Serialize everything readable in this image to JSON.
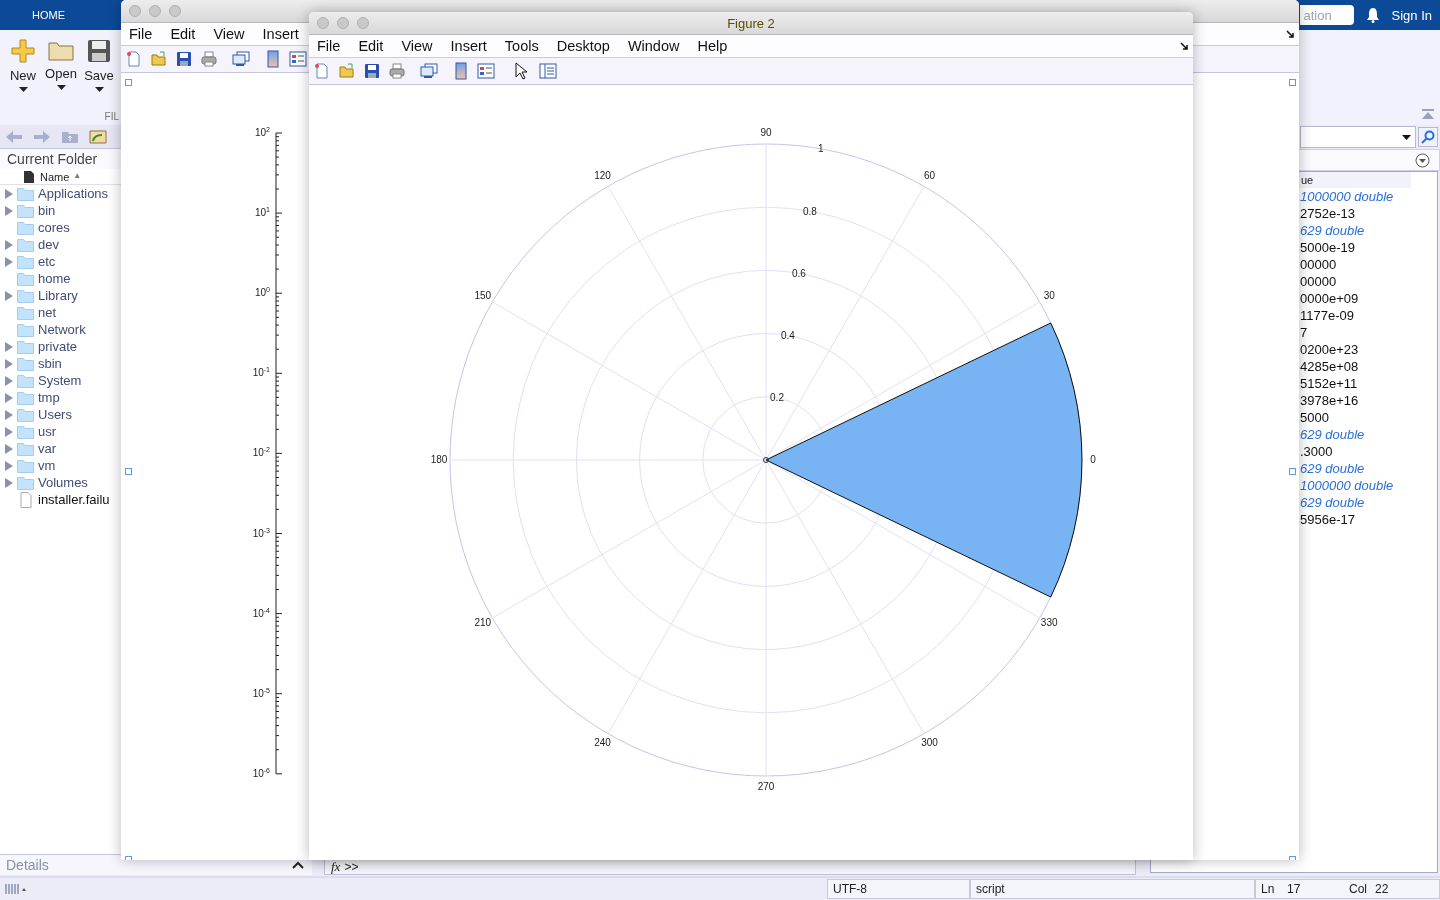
{
  "app": {
    "home_tab": "HOME",
    "search": {
      "value": "ation"
    },
    "sign_in": "Sign In",
    "ribbon": {
      "buttons": [
        {
          "label": "New",
          "kind": "new"
        },
        {
          "label": "Open",
          "kind": "open"
        },
        {
          "label": "Save",
          "kind": "save"
        }
      ],
      "section": "FIL"
    }
  },
  "current_folder": {
    "title": "Current Folder",
    "column": "Name",
    "sort": "▲",
    "items": [
      {
        "name": "Applications",
        "kind": "folder",
        "expandable": true
      },
      {
        "name": "bin",
        "kind": "folder",
        "expandable": true
      },
      {
        "name": "cores",
        "kind": "folder",
        "expandable": false
      },
      {
        "name": "dev",
        "kind": "folder",
        "expandable": true
      },
      {
        "name": "etc",
        "kind": "folder",
        "expandable": true
      },
      {
        "name": "home",
        "kind": "folder",
        "expandable": false
      },
      {
        "name": "Library",
        "kind": "folder",
        "expandable": true
      },
      {
        "name": "net",
        "kind": "folder",
        "expandable": false
      },
      {
        "name": "Network",
        "kind": "folder",
        "expandable": false
      },
      {
        "name": "private",
        "kind": "folder",
        "expandable": true
      },
      {
        "name": "sbin",
        "kind": "folder",
        "expandable": true
      },
      {
        "name": "System",
        "kind": "folder",
        "expandable": true
      },
      {
        "name": "tmp",
        "kind": "folder",
        "expandable": true
      },
      {
        "name": "Users",
        "kind": "folder",
        "expandable": true
      },
      {
        "name": "usr",
        "kind": "folder",
        "expandable": true
      },
      {
        "name": "var",
        "kind": "folder",
        "expandable": true
      },
      {
        "name": "vm",
        "kind": "folder",
        "expandable": true
      },
      {
        "name": "Volumes",
        "kind": "folder",
        "expandable": true
      },
      {
        "name": "installer.failu",
        "kind": "file",
        "expandable": false
      }
    ]
  },
  "details": {
    "label": "Details"
  },
  "command_window": {
    "fx": "fx",
    "prompt": ">>"
  },
  "workspace": {
    "column": "ue",
    "rows": [
      {
        "value": "1000000 double",
        "kind": "array"
      },
      {
        "value": "2752e-13",
        "kind": "scalar"
      },
      {
        "value": "629 double",
        "kind": "array"
      },
      {
        "value": "5000e-19",
        "kind": "scalar"
      },
      {
        "value": "00000",
        "kind": "scalar"
      },
      {
        "value": "00000",
        "kind": "scalar"
      },
      {
        "value": "0000e+09",
        "kind": "scalar"
      },
      {
        "value": "1177e-09",
        "kind": "scalar"
      },
      {
        "value": "7",
        "kind": "scalar"
      },
      {
        "value": "0200e+23",
        "kind": "scalar"
      },
      {
        "value": "4285e+08",
        "kind": "scalar"
      },
      {
        "value": "5152e+11",
        "kind": "scalar"
      },
      {
        "value": "3978e+16",
        "kind": "scalar"
      },
      {
        "value": "5000",
        "kind": "scalar"
      },
      {
        "value": "629 double",
        "kind": "array"
      },
      {
        "value": ".3000",
        "kind": "scalar"
      },
      {
        "value": "629 double",
        "kind": "array"
      },
      {
        "value": "1000000 double",
        "kind": "array"
      },
      {
        "value": "629 double",
        "kind": "array"
      },
      {
        "value": "5956e-17",
        "kind": "scalar"
      }
    ]
  },
  "status_bar": {
    "encoding": "UTF-8",
    "file_type": "script",
    "line_label": "Ln",
    "line": "17",
    "col_label": "Col",
    "col": "22"
  },
  "figure_1": {
    "menu": [
      "File",
      "Edit",
      "View",
      "Insert"
    ],
    "y_tick_labels": [
      "10$^{2}$",
      "10$^{1}$",
      "10$^{0}$",
      "10$^{-1}$",
      "10$^{-2}$",
      "10$^{-3}$",
      "10$^{-4}$",
      "10$^{-5}$",
      "10$^{-6}$"
    ]
  },
  "figure_2": {
    "title": "Figure 2",
    "menu": [
      "File",
      "Edit",
      "View",
      "Insert",
      "Tools",
      "Desktop",
      "Window",
      "Help"
    ],
    "polar": {
      "angle_labels": [
        "90",
        "60",
        "30",
        "0",
        "330",
        "300",
        "270",
        "240",
        "210",
        "180",
        "150",
        "120"
      ],
      "radius_labels": [
        "0.2",
        "0.4",
        "0.6",
        "0.8",
        "1"
      ]
    }
  }
}
